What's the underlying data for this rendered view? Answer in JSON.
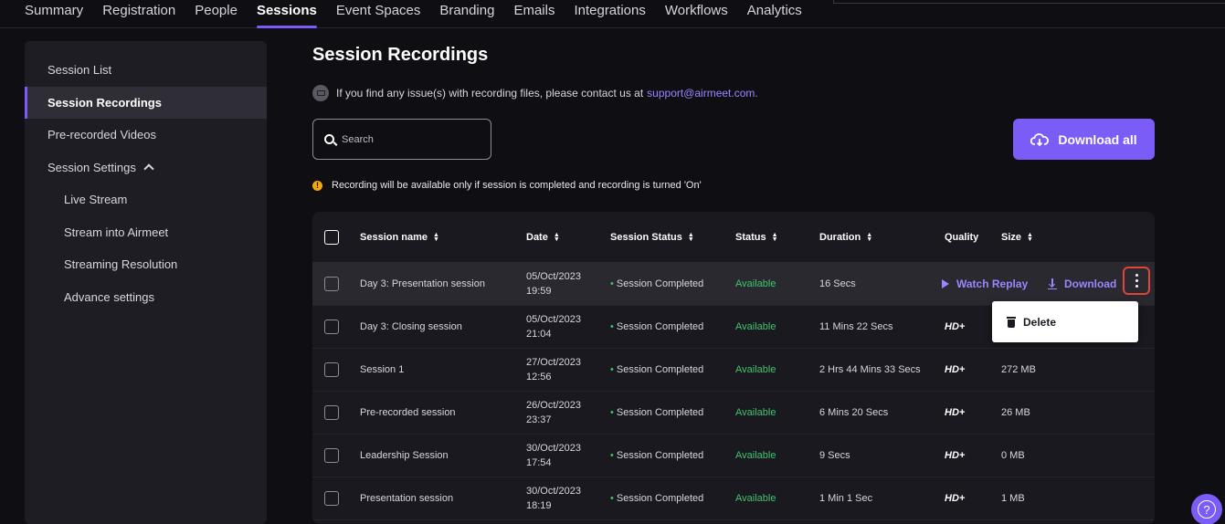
{
  "nav": {
    "tabs": [
      "Summary",
      "Registration",
      "People",
      "Sessions",
      "Event Spaces",
      "Branding",
      "Emails",
      "Integrations",
      "Workflows",
      "Analytics"
    ],
    "active": "Sessions"
  },
  "sidebar": {
    "items": [
      {
        "label": "Session List"
      },
      {
        "label": "Session Recordings"
      },
      {
        "label": "Pre-recorded Videos"
      },
      {
        "label": "Session Settings"
      },
      {
        "label": "Live Stream"
      },
      {
        "label": "Stream into Airmeet"
      },
      {
        "label": "Streaming Resolution"
      },
      {
        "label": "Advance settings"
      }
    ]
  },
  "main": {
    "title": "Session Recordings",
    "info_text": "If you find any issue(s) with recording files, please contact us at",
    "support_email": "support@airmeet.com.",
    "search_placeholder": "Search",
    "download_all": "Download all",
    "notice": "Recording will be available only if session is completed and recording is turned 'On'"
  },
  "table": {
    "headers": {
      "name": "Session name",
      "date": "Date",
      "session_status": "Session Status",
      "status": "Status",
      "duration": "Duration",
      "quality": "Quality",
      "size": "Size"
    },
    "rows": [
      {
        "name": "Day 3: Presentation session",
        "date": "05/Oct/2023",
        "time": "19:59",
        "session_status": "Session Completed",
        "status": "Available",
        "duration": "16 Secs",
        "quality": "",
        "size": ""
      },
      {
        "name": "Day 3: Closing session",
        "date": "05/Oct/2023",
        "time": "21:04",
        "session_status": "Session Completed",
        "status": "Available",
        "duration": "11 Mins 22 Secs",
        "quality": "HD+",
        "size": ""
      },
      {
        "name": "Session 1",
        "date": "27/Oct/2023",
        "time": "12:56",
        "session_status": "Session Completed",
        "status": "Available",
        "duration": "2 Hrs 44 Mins 33 Secs",
        "quality": "HD+",
        "size": "272 MB"
      },
      {
        "name": "Pre-recorded session",
        "date": "26/Oct/2023",
        "time": "23:37",
        "session_status": "Session Completed",
        "status": "Available",
        "duration": "6 Mins 20 Secs",
        "quality": "HD+",
        "size": "26 MB"
      },
      {
        "name": "Leadership Session",
        "date": "30/Oct/2023",
        "time": "17:54",
        "session_status": "Session Completed",
        "status": "Available",
        "duration": "9 Secs",
        "quality": "HD+",
        "size": "0 MB"
      },
      {
        "name": "Presentation session",
        "date": "30/Oct/2023",
        "time": "18:19",
        "session_status": "Session Completed",
        "status": "Available",
        "duration": "1 Min 1 Sec",
        "quality": "HD+",
        "size": "1 MB"
      }
    ],
    "actions": {
      "watch": "Watch Replay",
      "download": "Download"
    }
  },
  "menu": {
    "delete": "Delete"
  },
  "help": "?"
}
